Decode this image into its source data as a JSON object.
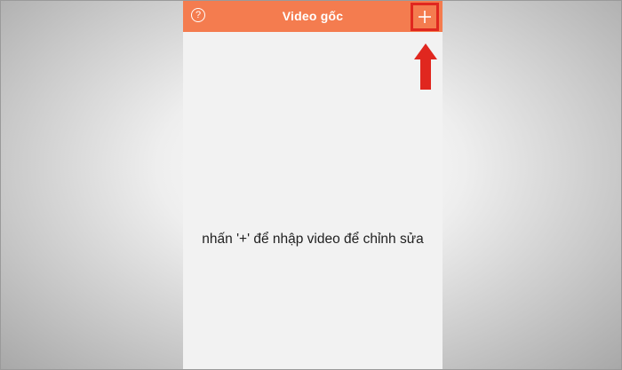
{
  "header": {
    "title": "Video gốc",
    "help_icon": "question-circle-icon",
    "help_glyph": "?",
    "add_icon": "plus-icon"
  },
  "main": {
    "hint": "nhấn '+' để nhập video để chỉnh sửa"
  },
  "colors": {
    "header_bg": "#f47c4f",
    "screen_bg": "#f2f2f2",
    "annotation_red": "#e0271f"
  }
}
